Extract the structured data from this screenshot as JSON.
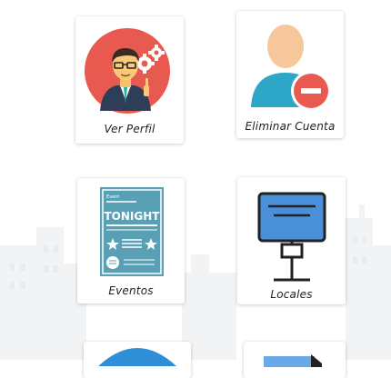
{
  "menu": {
    "items": [
      {
        "label": "Ver Perfil",
        "icon": "user-settings-icon"
      },
      {
        "label": "Eliminar Cuenta",
        "icon": "remove-user-icon"
      },
      {
        "label": "Eventos",
        "icon": "event-poster-icon"
      },
      {
        "label": "Locales",
        "icon": "signboard-icon"
      }
    ]
  },
  "poster": {
    "small": "Event",
    "headline": "TONIGHT"
  },
  "colors": {
    "accent_red": "#e85a4f",
    "accent_blue": "#4a90d9",
    "poster_teal": "#5aa0b5"
  }
}
